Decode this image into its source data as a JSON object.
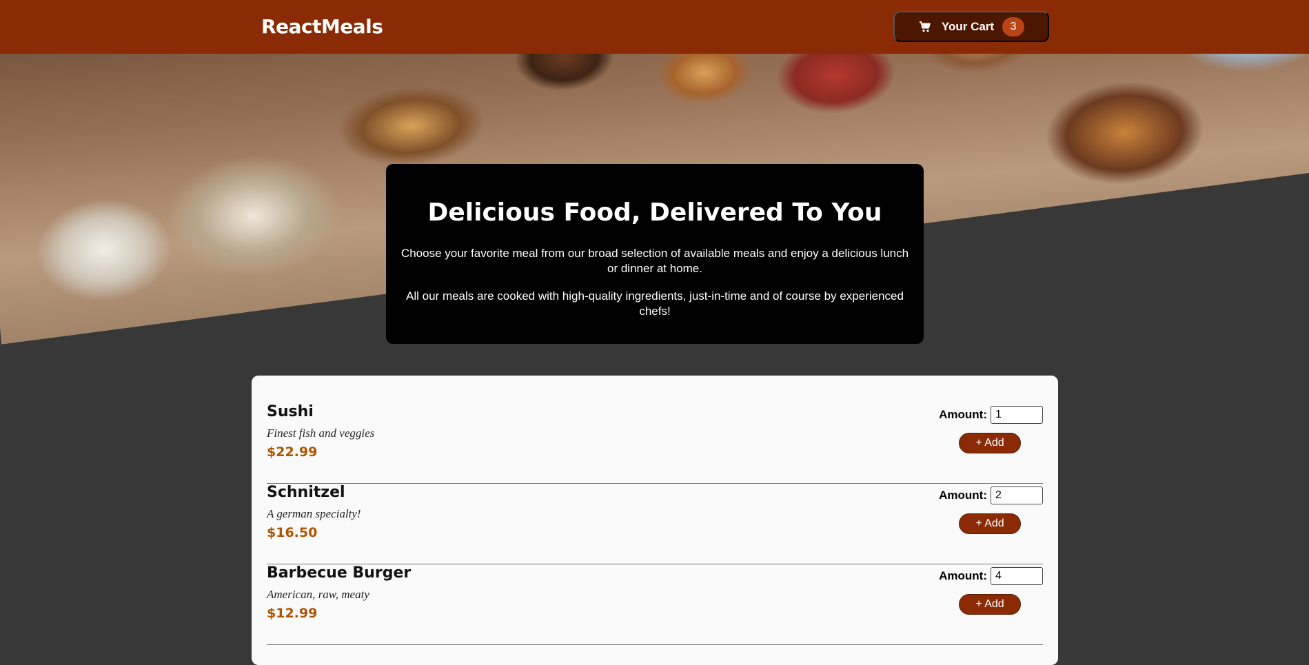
{
  "header": {
    "title": "ReactMeals",
    "cart_label": "Your Cart",
    "cart_count": "3",
    "cart_icon": "cart-icon"
  },
  "summary": {
    "heading": "Delicious Food, Delivered To You",
    "paragraph1": "Choose your favorite meal from our broad selection of available meals and enjoy a delicious lunch or dinner at home.",
    "paragraph2": "All our meals are cooked with high-quality ingredients, just-in-time and of course by experienced chefs!"
  },
  "meals": {
    "amount_label": "Amount:",
    "add_label": "+ Add",
    "items": [
      {
        "name": "Sushi",
        "description": "Finest fish and veggies",
        "price": "$22.99",
        "amount": "1"
      },
      {
        "name": "Schnitzel",
        "description": "A german specialty!",
        "price": "$16.50",
        "amount": "2"
      },
      {
        "name": "Barbecue Burger",
        "description": "American, raw, meaty",
        "price": "$12.99",
        "amount": "4"
      }
    ]
  },
  "colors": {
    "header_bg": "#8a2b06",
    "cart_bg": "#4d1601",
    "badge_bg": "#b94517",
    "page_bg": "#383838",
    "price": "#ad5502"
  }
}
